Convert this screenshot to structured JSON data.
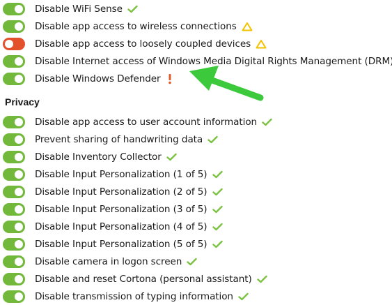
{
  "colors": {
    "toggle_on": "#72b83a",
    "toggle_off": "#e2502c",
    "check": "#7cc242",
    "warning": "#f2c200",
    "alert": "#e05a28",
    "arrow": "#3cc93c"
  },
  "settings_group_1": [
    {
      "label": "Disable WiFi Sense",
      "state": "on",
      "status_icon": "check-icon"
    },
    {
      "label": "Disable app access to wireless connections",
      "state": "on",
      "status_icon": "warning-triangle-icon"
    },
    {
      "label": "Disable app access to loosely coupled devices",
      "state": "off",
      "status_icon": "warning-triangle-icon"
    },
    {
      "label": "Disable Internet access of Windows Media Digital Rights Management (DRM)",
      "state": "on",
      "status_icon": "none"
    },
    {
      "label": "Disable Windows Defender",
      "state": "on",
      "status_icon": "exclamation-icon"
    }
  ],
  "privacy": {
    "title": "Privacy",
    "items": [
      {
        "label": "Disable app access to user account information",
        "state": "on",
        "status_icon": "check-icon"
      },
      {
        "label": "Prevent sharing of handwriting data",
        "state": "on",
        "status_icon": "check-icon"
      },
      {
        "label": "Disable Inventory Collector",
        "state": "on",
        "status_icon": "check-icon"
      },
      {
        "label": "Disable Input Personalization (1 of 5)",
        "state": "on",
        "status_icon": "check-icon"
      },
      {
        "label": "Disable Input Personalization (2 of 5)",
        "state": "on",
        "status_icon": "check-icon"
      },
      {
        "label": "Disable Input Personalization (3 of 5)",
        "state": "on",
        "status_icon": "check-icon"
      },
      {
        "label": "Disable Input Personalization (4 of 5)",
        "state": "on",
        "status_icon": "check-icon"
      },
      {
        "label": "Disable Input Personalization (5 of 5)",
        "state": "on",
        "status_icon": "check-icon"
      },
      {
        "label": "Disable camera in logon screen",
        "state": "on",
        "status_icon": "check-icon"
      },
      {
        "label": "Disable and reset Cortona (personal assistant)",
        "state": "on",
        "status_icon": "check-icon"
      },
      {
        "label": "Disable transmission of typing information",
        "state": "on",
        "status_icon": "check-icon"
      }
    ]
  },
  "annotation": {
    "icon": "arrow-icon",
    "points_to": "Disable Windows Defender"
  }
}
